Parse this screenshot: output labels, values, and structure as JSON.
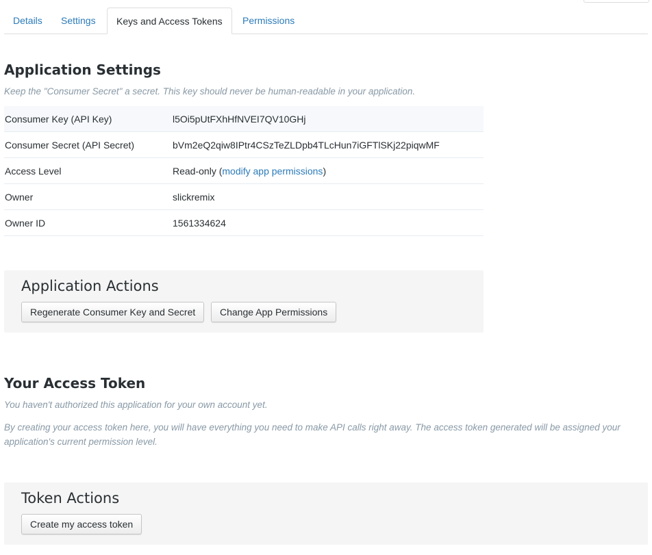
{
  "tabs": [
    {
      "label": "Details"
    },
    {
      "label": "Settings"
    },
    {
      "label": "Keys and Access Tokens"
    },
    {
      "label": "Permissions"
    }
  ],
  "app_settings": {
    "title": "Application Settings",
    "hint": "Keep the \"Consumer Secret\" a secret. This key should never be human-readable in your application.",
    "rows": [
      {
        "key": "Consumer Key (API Key)",
        "value": "l5Oi5pUtFXhHfNVEI7QV10GHj"
      },
      {
        "key": "Consumer Secret (API Secret)",
        "value": "bVm2eQ2qiw8IPtr4CSzTeZLDpb4TLcHun7iGFTlSKj22piqwMF"
      },
      {
        "key": "Access Level",
        "value": "Read-only (",
        "link": "modify app permissions",
        "suffix": ")"
      },
      {
        "key": "Owner",
        "value": "slickremix"
      },
      {
        "key": "Owner ID",
        "value": "1561334624"
      }
    ]
  },
  "app_actions": {
    "title": "Application Actions",
    "regenerate_label": "Regenerate Consumer Key and Secret",
    "change_permissions_label": "Change App Permissions"
  },
  "access_token": {
    "title": "Your Access Token",
    "hint1": "You haven't authorized this application for your own account yet.",
    "hint2": "By creating your access token here, you will have everything you need to make API calls right away. The access token generated will be assigned your application's current permission level."
  },
  "token_actions": {
    "title": "Token Actions",
    "create_label": "Create my access token"
  },
  "colors": {
    "link": "#2b7bb9",
    "text": "#292f33",
    "muted": "#8899a6",
    "panel": "#f5f5f5"
  }
}
